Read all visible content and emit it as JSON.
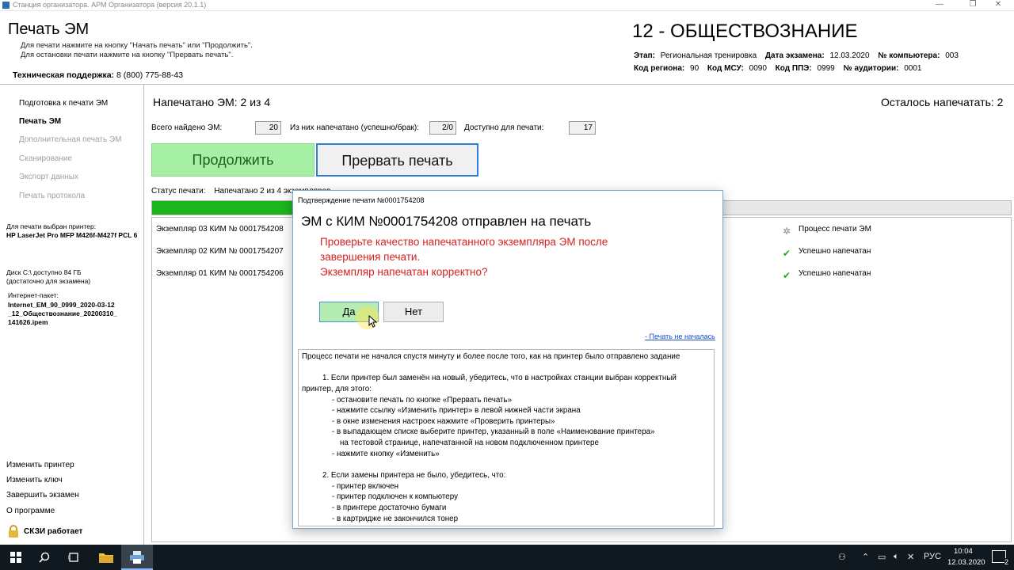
{
  "window": {
    "title": "Станция организатора. АРМ Организатора (версия 20.1.1)",
    "controls": [
      "—",
      "❐",
      "✕"
    ]
  },
  "header": {
    "title": "Печать ЭМ",
    "note1": "Для печати нажмите на кнопку \"Начать печать\" или \"Продолжить\".",
    "note2": "Для остановки печати нажмите на кнопку \"Прервать печать\".",
    "support_label": "Техническая поддержка:",
    "support_phone": "8 (800) 775-88-43",
    "subject": "12 - ОБЩЕСТВОЗНАНИЕ",
    "stage_label": "Этап:",
    "stage_value": "Региональная тренировка",
    "exam_date_label": "Дата экзамена:",
    "exam_date_value": "12.03.2020",
    "computer_label": "№ компьютера:",
    "computer_value": "003",
    "region_label": "Код региона:",
    "region_value": "90",
    "msu_label": "Код МСУ:",
    "msu_value": "0090",
    "ppe_label": "Код ППЭ:",
    "ppe_value": "0999",
    "room_label": "№ аудитории:",
    "room_value": "0001"
  },
  "sidebar": {
    "items": [
      {
        "label": "Подготовка к печати ЭМ",
        "state": "normal"
      },
      {
        "label": "Печать ЭМ",
        "state": "active"
      },
      {
        "label": "Дополнительная печать ЭМ",
        "state": "disabled"
      },
      {
        "label": "Сканирование",
        "state": "disabled"
      },
      {
        "label": "Экспорт данных",
        "state": "disabled"
      },
      {
        "label": "Печать протокола",
        "state": "disabled"
      }
    ],
    "printer_label": "Для печати выбран принтер:",
    "printer_name": "HP LaserJet Pro MFP M426f-M427f PCL 6",
    "disk_line1": "Диск C:\\ доступно 84 ГБ",
    "disk_line2": "(достаточно для экзамена)",
    "package_label": "Интернет-пакет:",
    "package_name_1": "Internet_EM_90_0999_2020-03-12",
    "package_name_2": "_12_Обществознание_20200310_",
    "package_name_3": "141626.ipem",
    "links": [
      "Изменить принтер",
      "Изменить ключ",
      "Завершить экзамен",
      "О программе"
    ],
    "skzi_status": "СКЗИ работает"
  },
  "main": {
    "printed_text": "Напечатано ЭМ:  2  из  4",
    "remaining_text": "Осталось напечатать:  2",
    "found_label": "Всего найдено ЭМ:",
    "found_value": "20",
    "printed_label": "Из них напечатано (успешно/брак):",
    "printed_value": "2/0",
    "available_label": "Доступно для печати:",
    "available_value": "17",
    "continue_button": "Продолжить",
    "abort_button": "Прервать печать",
    "status_label": "Статус печати:",
    "status_value": "Напечатано 2 из 4 экземпляров",
    "progress_fraction": 0.5,
    "copies": [
      {
        "name": "Экземпляр 03  КИМ № 0001754208",
        "status": "Процесс печати ЭМ",
        "icon": "spinner"
      },
      {
        "name": "Экземпляр 02  КИМ № 0001754207",
        "status": "Успешно напечатан",
        "icon": "check"
      },
      {
        "name": "Экземпляр 01  КИМ № 0001754206",
        "status": "Успешно напечатан",
        "icon": "check"
      }
    ]
  },
  "dialog": {
    "title": "Подтверждение печати  №0001754208",
    "heading": "ЭМ с КИМ №0001754208 отправлен на печать",
    "red_line1": "Проверьте качество напечатанного экземпляра ЭМ после",
    "red_line2": "завершения печати.",
    "red_line3": "Экземпляр напечатан корректно?",
    "yes_button": "Да",
    "no_button": "Нет",
    "link_not_started": "- Печать не началась",
    "help_lines": [
      "Процесс печати не начался спустя минуту и более после того, как на принтер было отправлено задание",
      "1. Если принтер был заменён на новый, убедитесь, что в настройках станции выбран корректный",
      "принтер, для этого:",
      "- остановите печать по кнопке «Прервать печать»",
      "- нажмите ссылку «Изменить принтер» в левой нижней части экрана",
      "- в окне изменения настроек нажмите «Проверить принтеры»",
      "- в выпадающем списке выберите принтер, указанный в поле «Наименование принтера»",
      "на тестовой странице, напечатанной на новом подключенном принтере",
      "- нажмите кнопку «Изменить»",
      "2. Если замены принтера не было, убедитесь, что:",
      "- принтер включен",
      "- принтер подключен к компьютеру",
      "- в принтере достаточно бумаги",
      "- в картридже не закончился тонер"
    ]
  },
  "taskbar": {
    "lang": "РУС",
    "time": "10:04",
    "date": "12.03.2020",
    "notification_count": "2"
  },
  "colors": {
    "continue_bg": "#a6f0a6",
    "progress_fill": "#1cb51c",
    "warning_red": "#d42020",
    "accent_blue": "#2c7fd8"
  }
}
